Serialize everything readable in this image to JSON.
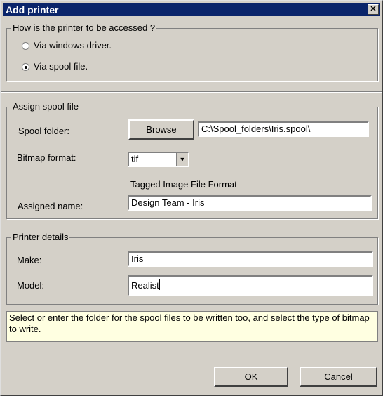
{
  "window": {
    "title": "Add printer"
  },
  "access": {
    "legend": "How is the printer to be accessed ?",
    "options": [
      {
        "label": "Via windows driver.",
        "selected": false
      },
      {
        "label": "Via spool file.",
        "selected": true
      }
    ]
  },
  "spool": {
    "legend": "Assign spool file",
    "folder_label": "Spool folder:",
    "browse_label": "Browse",
    "folder_value": "C:\\Spool_folders\\Iris.spool\\",
    "bitmap_label": "Bitmap format:",
    "bitmap_value": "tif",
    "bitmap_description": "Tagged Image File Format",
    "name_label": "Assigned name:",
    "name_value": "Design Team - Iris"
  },
  "printer": {
    "legend": "Printer details",
    "make_label": "Make:",
    "make_value": "Iris",
    "model_label": "Model:",
    "model_value": "Realist"
  },
  "hint": "Select or enter the folder for the spool files to be written too, and select the type of bitmap to write.",
  "buttons": {
    "ok": "OK",
    "cancel": "Cancel"
  },
  "icons": {
    "close": "close-icon",
    "dropdown": "chevron-down-icon"
  },
  "colors": {
    "titlebar": "#0a246a",
    "hint_background": "#ffffe1"
  }
}
